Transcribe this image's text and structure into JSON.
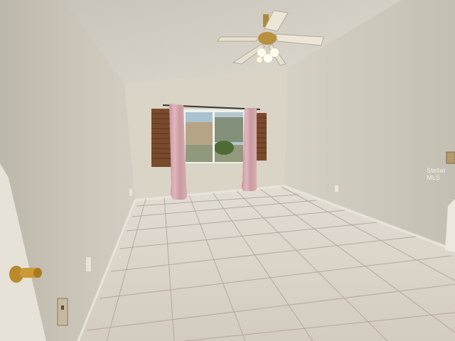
{
  "photo": {
    "watermark": "Stellar MLS"
  },
  "colors": {
    "ceiling": "#d6d2c8",
    "left_wall": "#c9c5b9",
    "back_wall": "#d9d4c6",
    "right_wall": "#d0cbbf",
    "floor_tile": "#d8d2c6",
    "grout": "#a89f93",
    "curtain": "#d8a9b0",
    "shutter": "#7a4a2c"
  },
  "icons": [
    "ceiling-fan-icon",
    "door-knob-icon",
    "outlet-icon",
    "light-switch-icon"
  ]
}
